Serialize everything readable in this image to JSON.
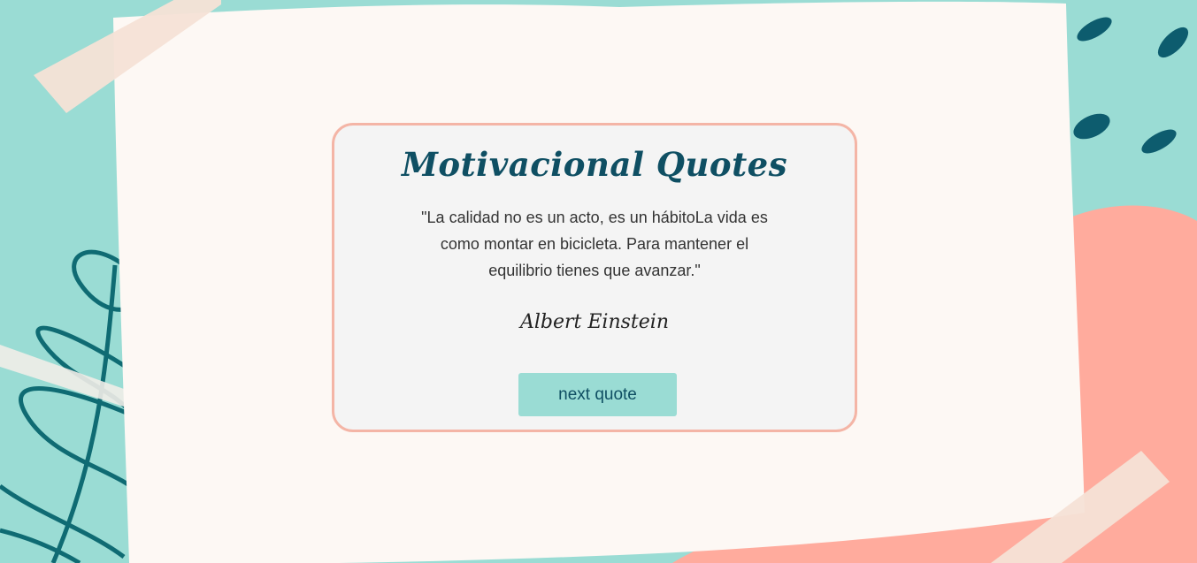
{
  "card": {
    "title": "Motivacional Quotes",
    "quote": "\"La calidad no es un acto, es un hábitoLa vida es como montar en bicicleta. Para mantener el equilibrio tienes que avanzar.\"",
    "author": "Albert Einstein",
    "next_button_label": "next quote"
  },
  "colors": {
    "background_teal": "#9adcd4",
    "paper": "#fdf8f4",
    "coral": "#ffab9d",
    "card_border": "#f4b5a6",
    "title_color": "#0f4f63",
    "button_bg": "#9adcd4"
  }
}
